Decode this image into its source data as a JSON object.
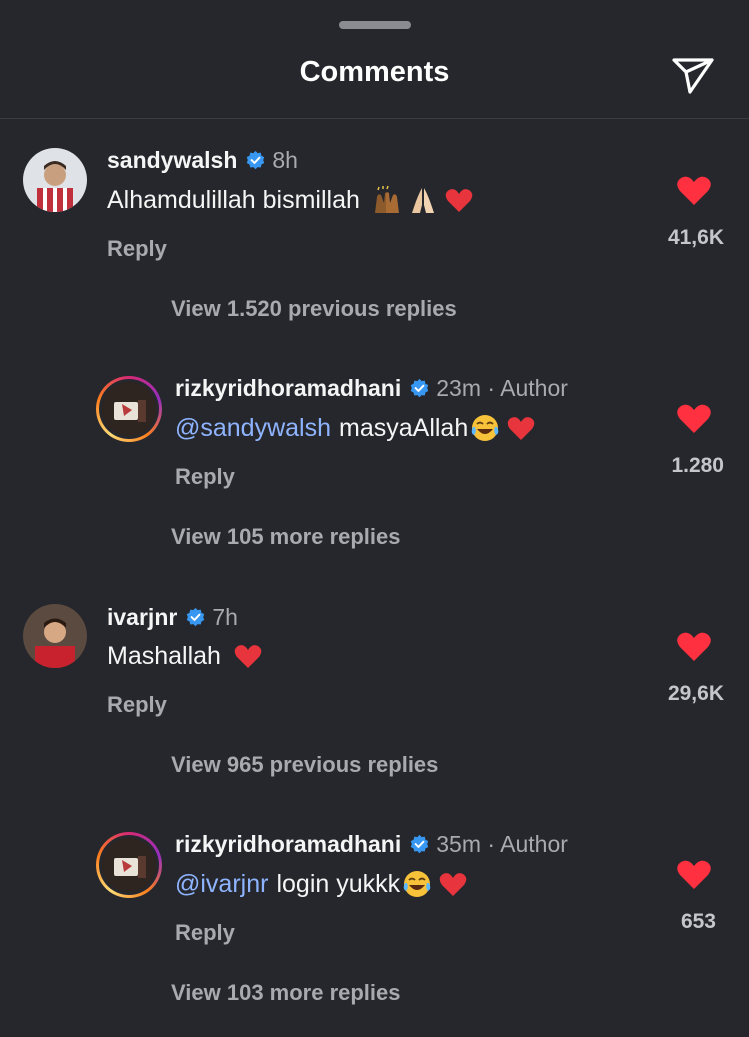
{
  "header": {
    "title": "Comments",
    "send_icon": "paper-plane-icon"
  },
  "comments": [
    {
      "username": "sandywalsh",
      "verified": true,
      "time": "8h",
      "text": "Alhamdulillah bismillah",
      "reply_label": "Reply",
      "likes": "41,6K",
      "view_replies": "View 1.520 previous replies",
      "reply": {
        "username": "rizkyridhoramadhani",
        "verified": true,
        "time": "23m · Author",
        "mention": "@sandywalsh",
        "text": "masyaAllah",
        "reply_label": "Reply",
        "likes": "1.280",
        "view_replies": "View 105 more replies"
      }
    },
    {
      "username": "ivarjnr",
      "verified": true,
      "time": "7h",
      "text": "Mashallah",
      "reply_label": "Reply",
      "likes": "29,6K",
      "view_replies": "View 965 previous replies",
      "reply": {
        "username": "rizkyridhoramadhani",
        "verified": true,
        "time": "35m · Author",
        "mention": "@ivarjnr",
        "text": "login yukkk",
        "reply_label": "Reply",
        "likes": "653",
        "view_replies": "View 103 more replies"
      }
    }
  ],
  "colors": {
    "background": "#25272c",
    "heart": "#ff3040",
    "verified": "#3897f0",
    "mention": "#8fb4ff"
  }
}
